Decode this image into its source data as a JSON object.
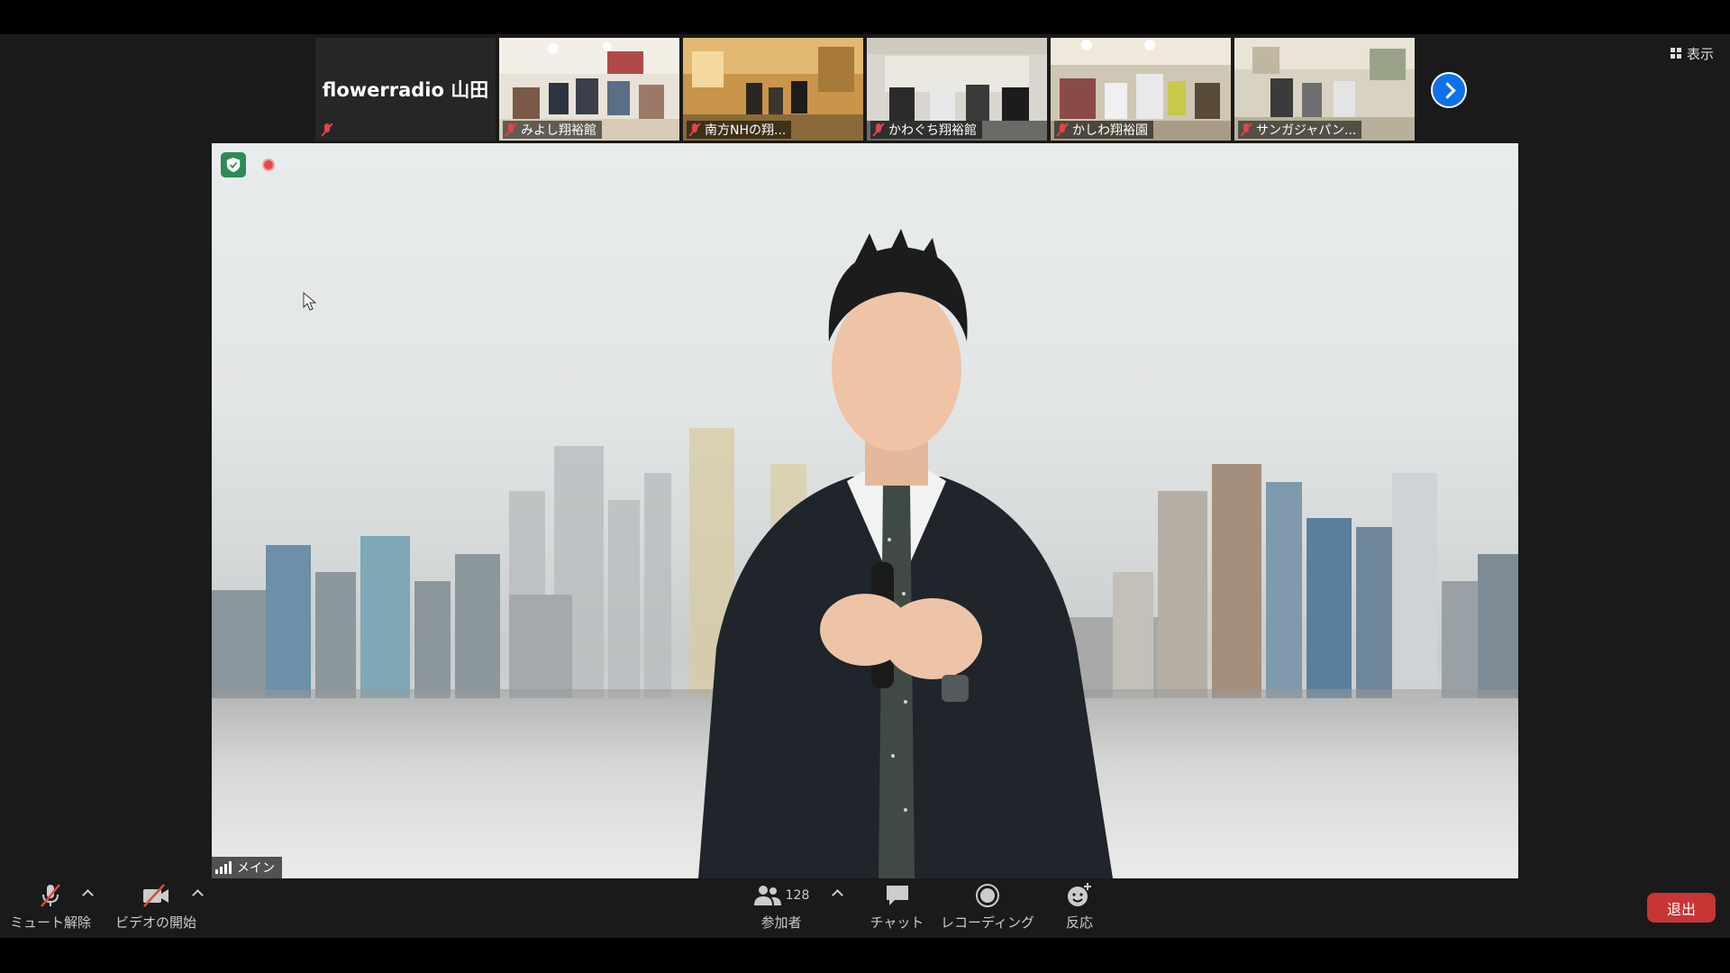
{
  "top": {
    "view_label": "表示"
  },
  "gallery": {
    "active_name": "flowerradio 山田",
    "participants": [
      {
        "name": "みよし翔裕館"
      },
      {
        "name": "南方NHの翔..."
      },
      {
        "name": "かわぐち翔裕館"
      },
      {
        "name": "かしわ翔裕園"
      },
      {
        "name": "サンガジャパン..."
      }
    ]
  },
  "main_video": {
    "label": "メイン"
  },
  "toolbar": {
    "mute_label": "ミュート解除",
    "video_label": "ビデオの開始",
    "participants_label": "参加者",
    "participants_count": "128",
    "chat_label": "チャット",
    "recording_label": "レコーディング",
    "reactions_label": "反応",
    "leave_label": "退出"
  },
  "colors": {
    "toolbar_bg": "#1a1a1a",
    "leave_red": "#c73535",
    "accent_blue": "#0e71eb",
    "muted_red": "#e04646",
    "security_green": "#2e8b57"
  }
}
